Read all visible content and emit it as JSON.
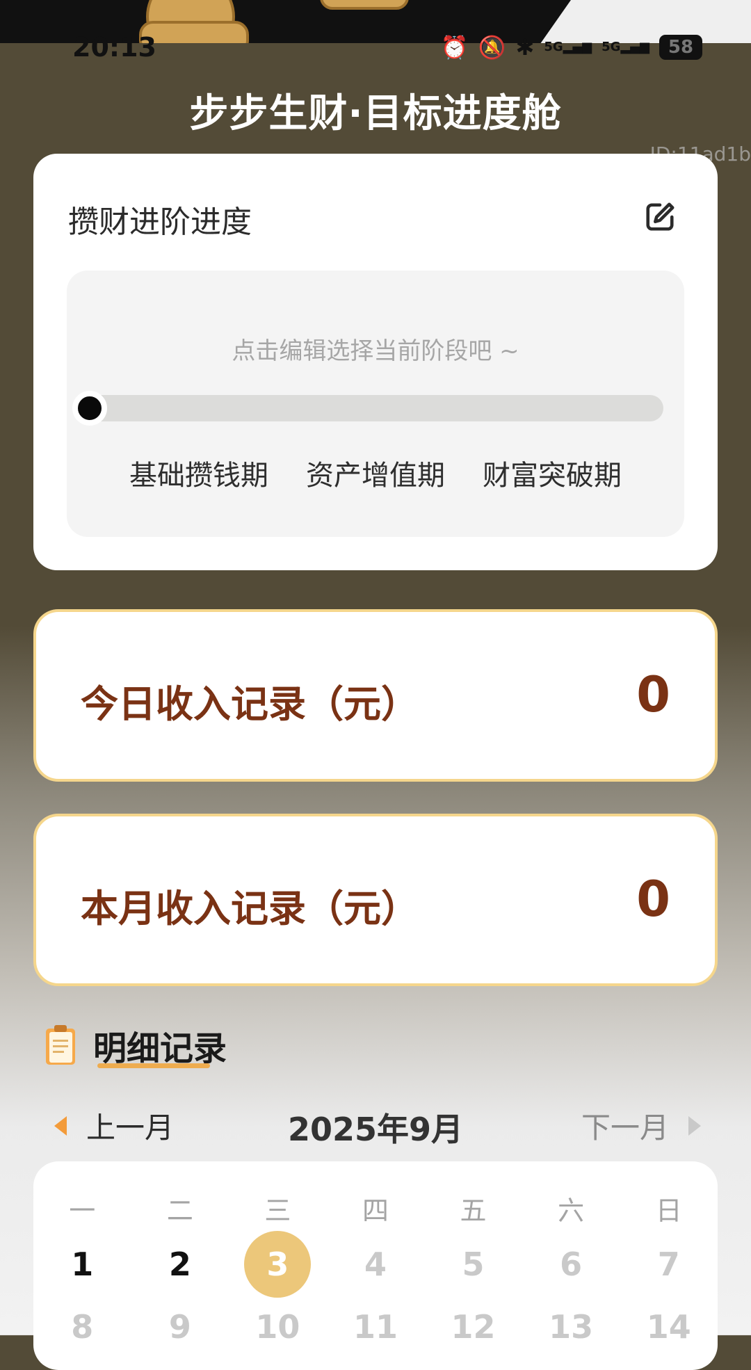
{
  "status_bar": {
    "time": "20:13",
    "battery": "58",
    "signal1": "5G",
    "signal2": "5G"
  },
  "header": {
    "title": "步步生财·目标进度舱",
    "watermark": "ID:11ad1b"
  },
  "progress_card": {
    "title": "攒财进阶进度",
    "hint": "点击编辑选择当前阶段吧 ~",
    "progress_fraction": 0,
    "stages": [
      "基础攒钱期",
      "资产增值期",
      "财富突破期"
    ]
  },
  "today_income": {
    "label": "今日收入记录（元）",
    "value": "0"
  },
  "month_income": {
    "label": "本月收入记录（元）",
    "value": "0"
  },
  "detail": {
    "title": "明细记录"
  },
  "month_nav": {
    "prev": "上一月",
    "current": "2025年9月",
    "next": "下一月"
  },
  "calendar": {
    "weekdays": [
      "一",
      "二",
      "三",
      "四",
      "五",
      "六",
      "日"
    ],
    "week1": [
      "1",
      "2",
      "3",
      "4",
      "5",
      "6",
      "7"
    ],
    "week2": [
      "8",
      "9",
      "10",
      "11",
      "12",
      "13",
      "14"
    ],
    "today": "3"
  },
  "colors": {
    "accent": "#7a3214",
    "border": "#f5d68c",
    "today": "#ecc77a",
    "background": "#534b37"
  }
}
